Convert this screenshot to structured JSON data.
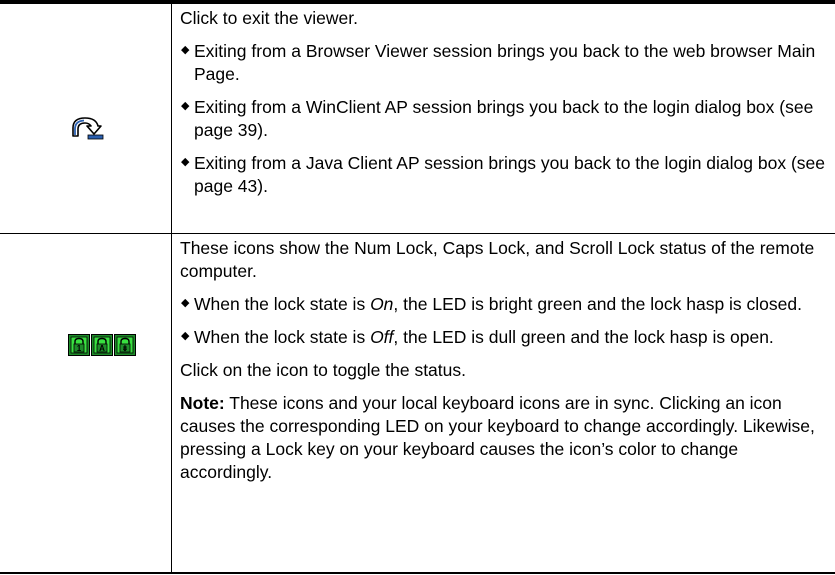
{
  "exit_row": {
    "icon": "exit-viewer-icon",
    "description": "Click to exit the viewer.",
    "bullets": [
      "Exiting from a Browser Viewer session brings you back to the web browser Main Page.",
      "Exiting from a WinClient AP session brings you back to the login dialog box (see page 39).",
      "Exiting from a Java Client AP session brings you back to the login dialog box (see page 43)."
    ]
  },
  "lock_row": {
    "icons": [
      "num-lock-icon",
      "caps-lock-icon",
      "scroll-lock-icon"
    ],
    "icon_letters": [
      "1",
      "A",
      "⇟"
    ],
    "description": "These icons show the Num Lock, Caps Lock, and Scroll Lock status of the remote computer.",
    "bullet_on": {
      "prefix": "When the lock state is ",
      "state": "On",
      "suffix": ", the LED is bright green and the lock hasp is closed."
    },
    "bullet_off": {
      "prefix": "When the lock state is ",
      "state": "Off",
      "suffix": ", the LED is dull green and the lock hasp is open."
    },
    "toggle_text": "Click on the icon to toggle the status.",
    "note_label": "Note:",
    "note_text": " These icons and your local keyboard icons are in sync. Clicking an icon causes the corresponding LED on your keyboard to change accordingly. Likewise, pressing a Lock key on your keyboard causes the icon’s color to change accordingly."
  },
  "colors": {
    "lock_icon_bg": "#1e8c2a",
    "lock_icon_light": "#38e040",
    "exit_icon_blue": "#2a5fb0"
  }
}
